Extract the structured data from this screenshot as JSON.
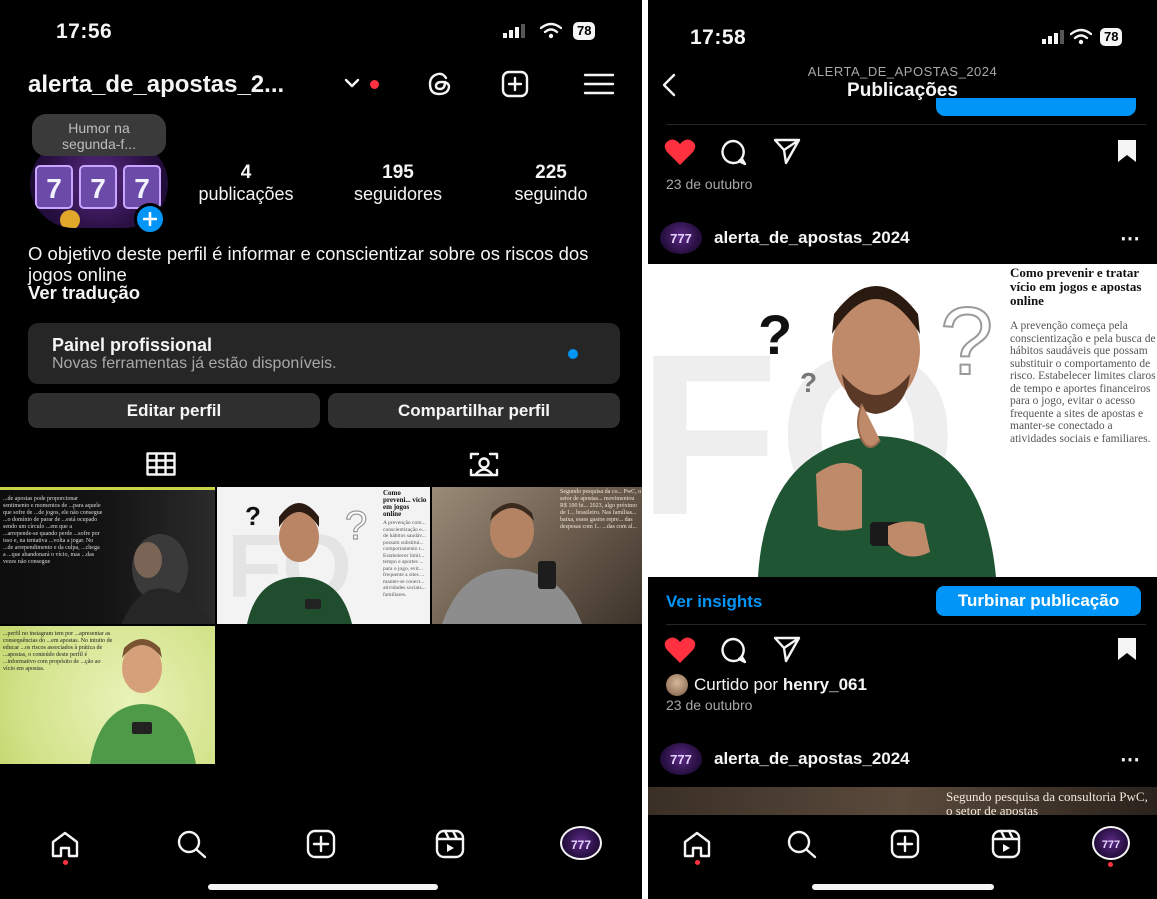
{
  "left": {
    "status": {
      "time": "17:56",
      "battery": "78"
    },
    "header": {
      "username": "alerta_de_apostas_2...",
      "chevron": "⌄"
    },
    "note": "Humor na segunda-f...",
    "stats": [
      {
        "value": "4",
        "label": "publicações"
      },
      {
        "value": "195",
        "label": "seguidores"
      },
      {
        "value": "225",
        "label": "seguindo"
      }
    ],
    "bio": "O objetivo deste perfil é informar e conscientizar sobre os riscos dos jogos online",
    "translate": "Ver tradução",
    "dashboard": {
      "title": "Painel profissional",
      "subtitle": "Novas ferramentas já estão disponíveis."
    },
    "buttons": {
      "edit": "Editar perfil",
      "share": "Compartilhar perfil"
    },
    "grid": {
      "post1_text": "...de apostas pode proporcionar sentimento e momentos de ...para aquele que sofre de ...de jogos, ele não consegue ...o domínio de parar de ...está ocupado sendo um círculo ...em que a ...arrepende-se quando perde ...sofre por isso e, na tentativa ...volta a jogar. No ...de arrependimento e da culpa, ...chega a ...que abandonará o vício, mas ...das vezes não consegue",
      "post2_title": "Como preveni... vício em jogos online",
      "post2_text": "A prevenção com... conscientização e... de hábitos saudáv... possam substitui... comportamento r... Estabelecer limit... tempo e aportes ... para o jogo, evit... frequente a sites ... manter-se conect... atividades sociais... familiares.",
      "post3_text": "Segundo pesquisa da co... PwC, o setor de apostas... movimentou R$ 100 bi... 2023, algo próximo de 1... brasileiro. Nas famílias... baixa, esses gastos repre... das despesas com f... ...das com al...",
      "post4_text": "...perfil no instagram tem por ...apresentar as consequências do ...em apostas. No intuito de educar ...os riscos associados à prática de ...apostas, o conteúdo deste perfil é ...informativo com propósito de ...ção ao vício em apostas."
    }
  },
  "right": {
    "status": {
      "time": "17:58",
      "battery": "78"
    },
    "header": {
      "account": "ALERTA_DE_APOSTAS_2024",
      "title": "Publicações"
    },
    "post_top": {
      "date": "23 de outubro"
    },
    "post_main": {
      "username": "alerta_de_apostas_2024",
      "image_title": "Como prevenir e tratar vício em jogos e apostas online",
      "image_text": "A prevenção começa pela conscientização e pela busca de hábitos saudáveis que possam substituir o comportamento de risco. Estabelecer limites claros de tempo e aportes financeiros para o jogo, evitar o acesso frequente a sites de apostas e manter-se conectado a atividades sociais e familiares.",
      "insights": "Ver insights",
      "boost": "Turbinar publicação",
      "liked_prefix": "Curtido por",
      "liked_user": "henry_061",
      "date": "23 de outubro"
    },
    "post_next": {
      "username": "alerta_de_apostas_2024",
      "image_text": "Segundo pesquisa da consultoria PwC, o setor de apostas"
    }
  },
  "colors": {
    "accent": "#0095f6",
    "like": "#ff3040",
    "surface": "#262626",
    "bg": "#000000"
  }
}
